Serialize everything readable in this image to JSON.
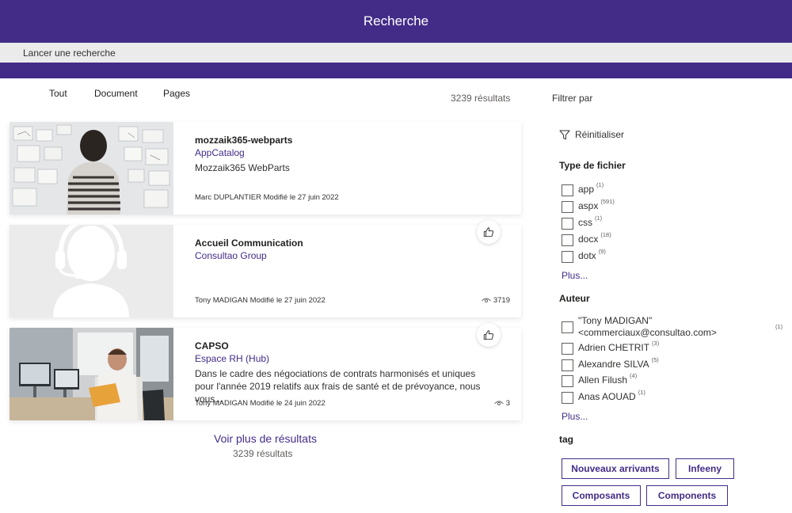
{
  "header": {
    "title": "Recherche"
  },
  "search": {
    "placeholder": "Lancer une recherche"
  },
  "tabs": [
    {
      "label": "Tout"
    },
    {
      "label": "Document"
    },
    {
      "label": "Pages"
    }
  ],
  "results_count_label": "3239 résultats",
  "filters": {
    "title": "Filtrer par",
    "reset_label": "Réinitialiser",
    "file_type": {
      "title": "Type de fichier",
      "options": [
        {
          "label": "app",
          "count": "(1)"
        },
        {
          "label": "aspx",
          "count": "(591)"
        },
        {
          "label": "css",
          "count": "(1)"
        },
        {
          "label": "docx",
          "count": "(18)"
        },
        {
          "label": "dotx",
          "count": "(9)"
        }
      ],
      "more_label": "Plus..."
    },
    "author": {
      "title": "Auteur",
      "options": [
        {
          "label": "\"Tony MADIGAN\" <commerciaux@consultao.com>",
          "count": "(1)"
        },
        {
          "label": "Adrien CHETRIT",
          "count": "(3)"
        },
        {
          "label": "Alexandre SILVA",
          "count": "(5)"
        },
        {
          "label": "Allen Filush",
          "count": "(4)"
        },
        {
          "label": "Anas AOUAD",
          "count": "(1)"
        }
      ],
      "more_label": "Plus..."
    },
    "tag": {
      "title": "tag",
      "items": [
        "Nouveaux arrivants",
        "Infeeny",
        "Composants",
        "Components"
      ]
    }
  },
  "results": [
    {
      "title": "mozzaik365-webparts",
      "site": "AppCatalog",
      "description": "Mozzaik365 WebParts",
      "meta": "Marc DUPLANTIER Modifié le 27 juin 2022",
      "views": ""
    },
    {
      "title": "Accueil Communication",
      "site": "Consultao Group",
      "description": "",
      "meta": "Tony MADIGAN Modifié le 27 juin 2022",
      "views": "3719"
    },
    {
      "title": "CAPSO",
      "site": "Espace RH (Hub)",
      "description": "Dans le cadre des négociations de contrats harmonisés et uniques pour l'année 2019 relatifs aux frais de santé et de prévoyance, nous vous...",
      "meta": "Tony MADIGAN Modifié le 24 juin 2022",
      "views": "3"
    }
  ],
  "footer": {
    "more_results_label": "Voir plus de résultats",
    "results_count": "3239 résultats"
  },
  "colors": {
    "brand": "#432c88",
    "search_bg": "#ebebeb",
    "placeholder_bg": "#eaeaea"
  },
  "icons": {
    "like": "thumbs-up-icon",
    "views": "eye-icon",
    "reset": "filter-icon"
  }
}
